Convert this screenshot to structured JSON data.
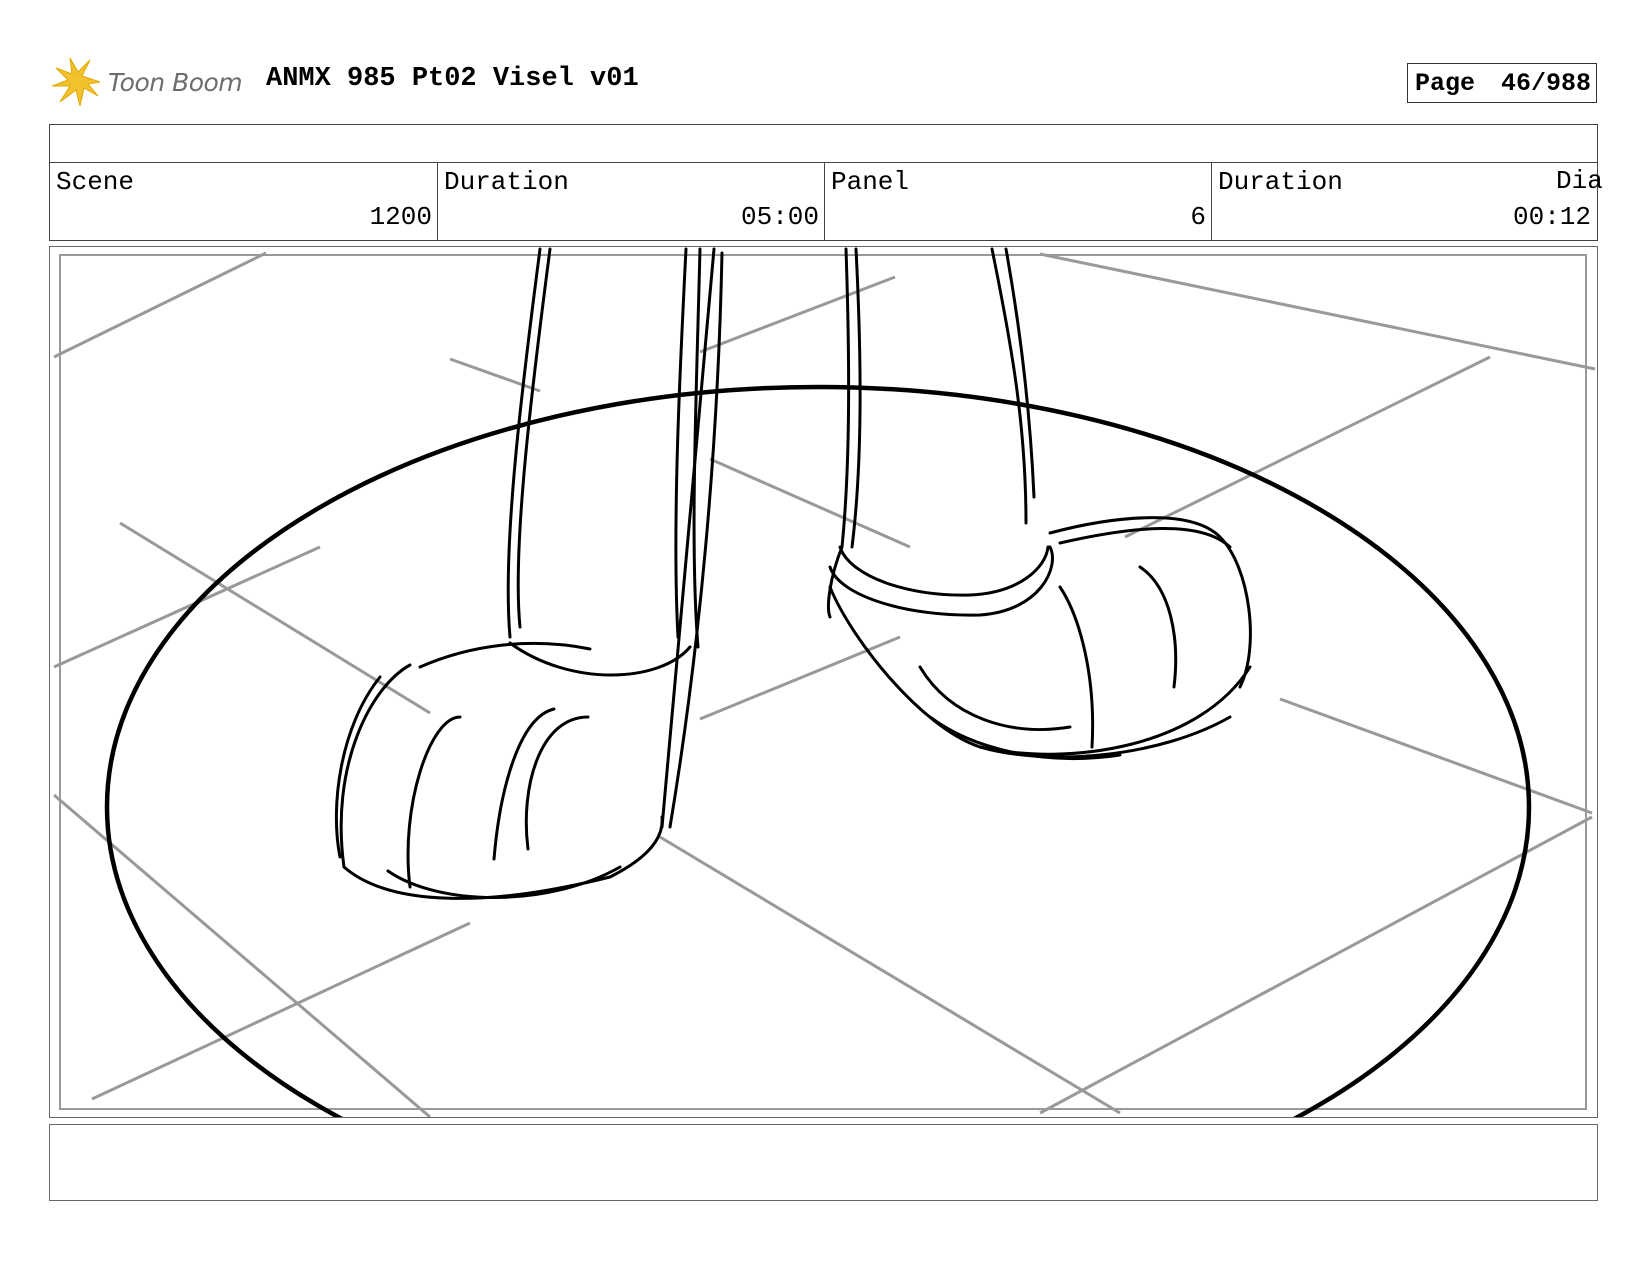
{
  "header": {
    "logo_text": "Toon Boom",
    "project_title": "ANMX 985 Pt02 Visel v01",
    "page_label": "Page",
    "page_number": "46/988"
  },
  "info_row": {
    "scene_label": "Scene",
    "scene_value": "1200",
    "scene_duration_label": "Duration",
    "scene_duration_value": "05:00",
    "panel_label": "Panel",
    "panel_value": "6",
    "panel_duration_label": "Duration",
    "panel_duration_value": "00:12",
    "dialogue_label_partial": "Dia"
  },
  "panel": {
    "content": "sketch",
    "stroke_color": "#000000",
    "guide_color": "#999999"
  },
  "colors": {
    "logo_star": "#f2c12e",
    "logo_text": "#6d6d6d",
    "border": "#444444"
  }
}
